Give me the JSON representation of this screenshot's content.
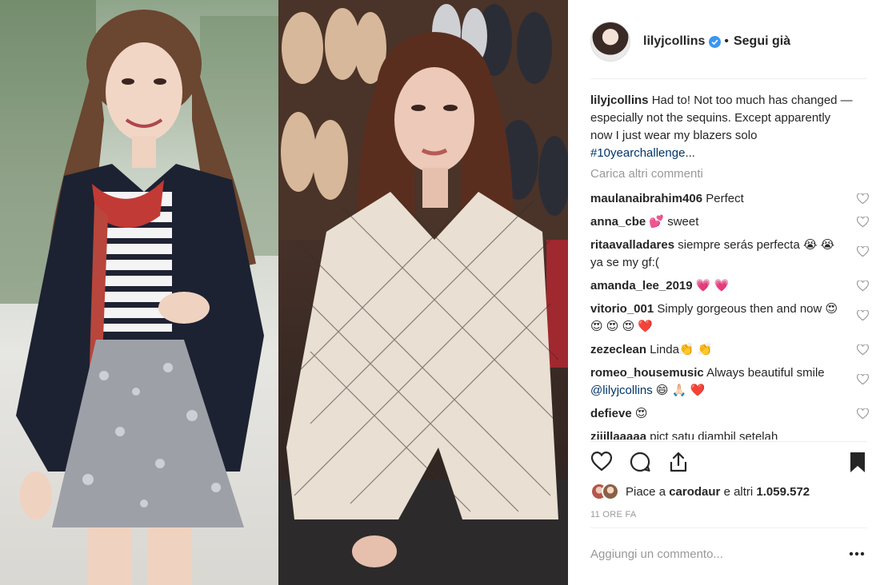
{
  "post": {
    "username": "lilyjcollins",
    "separator": "•",
    "follow_status": "Segui già",
    "caption": {
      "username": "lilyjcollins",
      "text": "Had to! Not too much has changed — especially not the sequins. Except apparently now I just wear my blazers solo ",
      "hashtag": "#10yearchallenge",
      "ellipsis": "..."
    },
    "load_more_comments": "Carica altri commenti",
    "comments": [
      {
        "user": "maulanaibrahim406",
        "text": "Perfect"
      },
      {
        "user": "anna_cbe",
        "text": "💕 sweet"
      },
      {
        "user": "ritaavalladares",
        "text": "siempre serás perfecta 😭 😭  ya se my gf:("
      },
      {
        "user": "amanda_lee_2019",
        "text": "💗 💗"
      },
      {
        "user": "vitorio_001",
        "text": "Simply gorgeous then and now 😍 😍 😍 😍 ❤️"
      },
      {
        "user": "zezeclean",
        "text": "Linda👏 👏"
      },
      {
        "user": "romeo_housemusic",
        "text": "Always beautiful smile ",
        "mention": "@lilyjcollins",
        "after": " 😄 🙏🏻 ❤️"
      },
      {
        "user": "defieve",
        "text": "😍"
      },
      {
        "user": "ziiillaaaaa",
        "text": "pict satu diambil setelah"
      }
    ],
    "likes": {
      "prefix": "Piace a ",
      "first_liker": "carodaur",
      "middle": " e altri ",
      "count": "1.059.572"
    },
    "time_ago": "11 ORE FA",
    "add_comment_placeholder": "Aggiungi un commento...",
    "icons": {
      "verified": "verified-badge-icon",
      "heart": "heart-icon",
      "comment": "comment-icon",
      "share": "share-icon",
      "save": "bookmark-icon",
      "more": "more-options-icon"
    },
    "colors": {
      "text": "#262626",
      "muted": "#999999",
      "link": "#003569",
      "verified": "#3897f0"
    }
  }
}
